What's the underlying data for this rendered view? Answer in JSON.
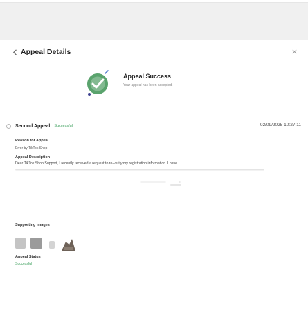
{
  "window": {
    "title": "Appeal Details"
  },
  "banner": {
    "title": "Appeal Success",
    "subtitle": "Your appeal has been accepted."
  },
  "appeal": {
    "name": "Second Appeal",
    "badge": "Successful",
    "date": "02/09/2025 10:27:11",
    "reason_label": "Reason for Appeal",
    "reason_value": "Error by TikTok Shop",
    "description_label": "Appeal Description",
    "description_value": "Dear TikTok Shop Support, I recently received a request to re-verify my registration information. I have",
    "images_label": "Supporting images",
    "status_label": "Appeal Status",
    "status_value": "Successful"
  },
  "colors": {
    "accent_green": "#3a9e5a",
    "background": "#f0f0f0",
    "panel": "#ffffff"
  },
  "icons": {
    "back": "chevron-left-icon",
    "close": "close-icon",
    "success": "check-badge-icon",
    "radio": "radio-icon"
  }
}
